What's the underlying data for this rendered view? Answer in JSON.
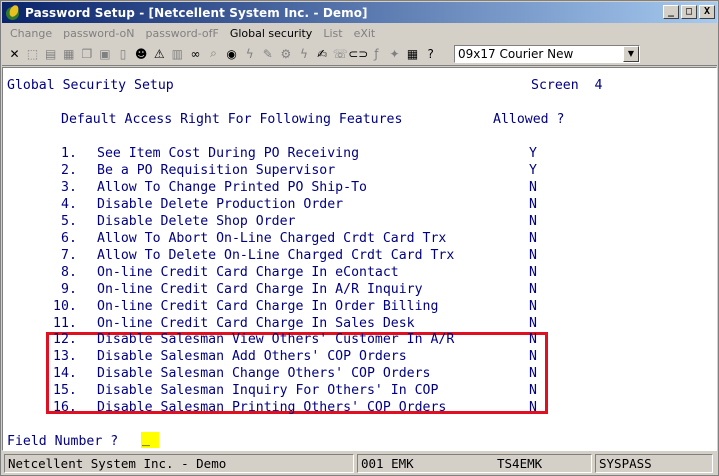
{
  "window": {
    "title": "Password Setup - [Netcellent System Inc. - Demo]",
    "buttons": {
      "minimize": "_",
      "maximize": "□",
      "close": "X"
    }
  },
  "menu": [
    {
      "label": "Change",
      "enabled": false
    },
    {
      "label": "password-oN",
      "enabled": false
    },
    {
      "label": "password-ofF",
      "enabled": false
    },
    {
      "label": "Global security",
      "enabled": true
    },
    {
      "label": "List",
      "enabled": false
    },
    {
      "label": "eXit",
      "enabled": false
    }
  ],
  "toolbar": {
    "tools": [
      {
        "icon": "close-x-icon",
        "glyph": "✕",
        "enabled": true
      },
      {
        "icon": "select-icon",
        "glyph": "⬚",
        "enabled": false
      },
      {
        "icon": "print-icon",
        "glyph": "▤",
        "enabled": false
      },
      {
        "icon": "print-setup-icon",
        "glyph": "▦",
        "enabled": false
      },
      {
        "icon": "copy-icon",
        "glyph": "❐",
        "enabled": false
      },
      {
        "icon": "paste-icon",
        "glyph": "▣",
        "enabled": false
      },
      {
        "icon": "doc-icon",
        "glyph": "▯",
        "enabled": false
      },
      {
        "icon": "user-icon",
        "glyph": "☻",
        "enabled": true
      },
      {
        "icon": "warning-icon",
        "glyph": "⚠",
        "enabled": true
      },
      {
        "icon": "book-icon",
        "glyph": "▥",
        "enabled": false
      },
      {
        "icon": "binoculars-icon",
        "glyph": "∞",
        "enabled": true
      },
      {
        "icon": "magnifier-icon",
        "glyph": "⌕",
        "enabled": false
      },
      {
        "icon": "globe-icon",
        "glyph": "◉",
        "enabled": true
      },
      {
        "icon": "lightning-icon",
        "glyph": "ϟ",
        "enabled": false
      },
      {
        "icon": "tool-icon",
        "glyph": "✎",
        "enabled": false
      },
      {
        "icon": "gear-icon",
        "glyph": "⚙",
        "enabled": false
      },
      {
        "icon": "lightning-blue-icon",
        "glyph": "ϟ",
        "enabled": false
      },
      {
        "icon": "script-icon",
        "glyph": "✍",
        "enabled": true
      },
      {
        "icon": "phone-icon",
        "glyph": "☏",
        "enabled": false
      },
      {
        "icon": "link-icon",
        "glyph": "⊂⊃",
        "enabled": true
      },
      {
        "icon": "function-icon",
        "glyph": "ƒ",
        "enabled": false
      },
      {
        "icon": "wand-icon",
        "glyph": "✦",
        "enabled": false
      },
      {
        "icon": "calculator-icon",
        "glyph": "▦",
        "enabled": true
      },
      {
        "icon": "help-cursor-icon",
        "glyph": "?",
        "enabled": true
      }
    ],
    "font_select": "09x17 Courier New"
  },
  "screen": {
    "header_left": "Global Security Setup",
    "header_right": "Screen  4",
    "subheader": "Default Access Right For Following Features",
    "allowed_header": "Allowed ?",
    "features": [
      {
        "num": "1.",
        "label": "See Item Cost During PO Receiving",
        "value": "Y"
      },
      {
        "num": "2.",
        "label": "Be a PO Requisition Supervisor",
        "value": "Y"
      },
      {
        "num": "3.",
        "label": "Allow To Change Printed PO Ship-To",
        "value": "N"
      },
      {
        "num": "4.",
        "label": "Disable Delete Production Order",
        "value": "N"
      },
      {
        "num": "5.",
        "label": "Disable Delete Shop Order",
        "value": "N"
      },
      {
        "num": "6.",
        "label": "Allow To Abort On-Line Charged Crdt Card Trx",
        "value": "N"
      },
      {
        "num": "7.",
        "label": "Allow To Delete On-Line Charged Crdt Card Trx",
        "value": "N"
      },
      {
        "num": "8.",
        "label": "On-line Credit Card Charge In eContact",
        "value": "N"
      },
      {
        "num": "9.",
        "label": "On-line Credit Card Charge In A/R Inquiry",
        "value": "N"
      },
      {
        "num": "10.",
        "label": "On-line Credit Card Charge In Order Billing",
        "value": "N"
      },
      {
        "num": "11.",
        "label": "On-line Credit Card Charge In Sales Desk",
        "value": "N"
      },
      {
        "num": "12.",
        "label": "Disable Salesman View Others' Customer In A/R",
        "value": "N"
      },
      {
        "num": "13.",
        "label": "Disable Salesman Add Others' COP Orders",
        "value": "N"
      },
      {
        "num": "14.",
        "label": "Disable Salesman Change Others' COP Orders",
        "value": "N"
      },
      {
        "num": "15.",
        "label": "Disable Salesman Inquiry For Others' In COP",
        "value": "N"
      },
      {
        "num": "16.",
        "label": "Disable Salesman Printing Others' COP Orders",
        "value": "N"
      }
    ],
    "prompt": "Field Number ?",
    "cursor": "_",
    "highlight_color": "#e01020"
  },
  "status": {
    "company": "Netcellent System Inc. - Demo",
    "user": "001 EMK",
    "terminal": "TS4EMK",
    "program": "SYSPASS"
  }
}
